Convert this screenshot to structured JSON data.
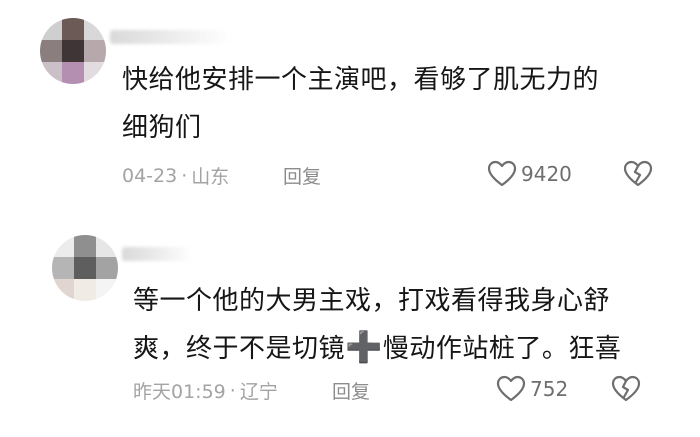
{
  "comments": [
    {
      "text_line1": "快给他安排一个主演吧，看够了肌无力的",
      "text_line2": "细狗们",
      "date": "04-23",
      "location": "山东",
      "reply_label": "回复",
      "likes": "9420",
      "like_icon": "heart-outline-icon",
      "dislike_icon": "broken-heart-icon"
    },
    {
      "text_line1": "等一个他的大男主戏，打戏看得我身心舒",
      "text_line2_a": "爽，终于不是切镜",
      "text_line2_emoji": "➕",
      "text_line2_b": "慢动作站桩了。狂喜",
      "date": "昨天01:59",
      "location": "辽宁",
      "reply_label": "回复",
      "likes": "752",
      "like_icon": "heart-outline-icon",
      "dislike_icon": "broken-heart-icon"
    }
  ],
  "meta_separator": "·"
}
